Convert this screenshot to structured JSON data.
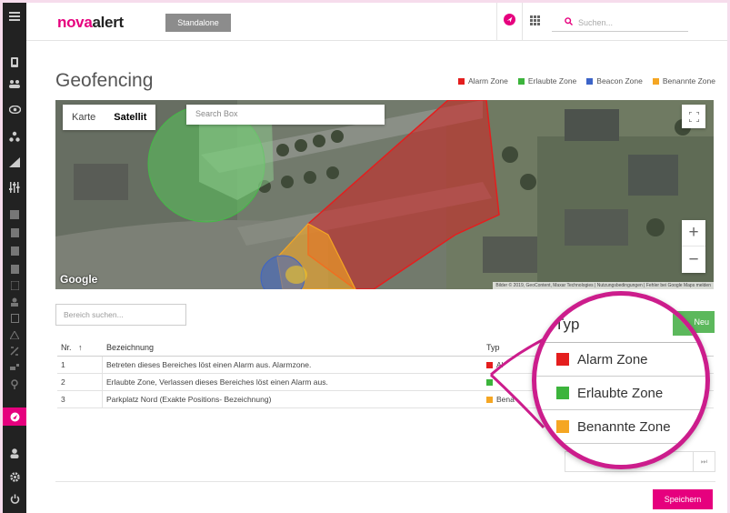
{
  "brand": {
    "part1": "nova",
    "part2": "alert"
  },
  "mode_label": "Standalone",
  "topbar": {
    "search_placeholder": "Suchen..."
  },
  "page": {
    "title": "Geofencing"
  },
  "legend": [
    {
      "label": "Alarm Zone",
      "color": "#e41e1e"
    },
    {
      "label": "Erlaubte Zone",
      "color": "#3cb43c"
    },
    {
      "label": "Beacon Zone",
      "color": "#3c64c8"
    },
    {
      "label": "Benannte Zone",
      "color": "#f5a623"
    }
  ],
  "map": {
    "tabs": [
      "Karte",
      "Satellit"
    ],
    "selected_tab": "Satellit",
    "search_placeholder": "Search Box",
    "google": "Google",
    "attribution": "Bilder © 2019, GeoContent, Maxar Technologies | Nutzungsbedingungen | Fehler bei Google Maps melden",
    "zoom_in": "+",
    "zoom_out": "−"
  },
  "filter": {
    "region_placeholder": "Bereich suchen..."
  },
  "add_button": "Neu",
  "table": {
    "headers": {
      "nr": "Nr.",
      "sort": "↑",
      "bez": "Bezeichnung",
      "typ": "Typ"
    },
    "rows": [
      {
        "nr": "1",
        "bez": "Betreten dieses Bereiches löst einen Alarm aus. Alarmzone.",
        "typ": "Al",
        "color": "#e41e1e"
      },
      {
        "nr": "2",
        "bez": "Erlaubte Zone, Verlassen dieses Bereiches löst einen Alarm aus.",
        "typ": "",
        "color": "#3cb43c"
      },
      {
        "nr": "3",
        "bez": "Parkplatz Nord (Exakte Positions- Bezeichnung)",
        "typ": "Bena",
        "color": "#f5a623"
      }
    ]
  },
  "pager": {
    "last": "⏭"
  },
  "save_button": "Speichern",
  "callout": {
    "header": "Typ",
    "rows": [
      {
        "label": "Alarm Zone",
        "color": "#e41e1e"
      },
      {
        "label": "Erlaubte Zone",
        "color": "#3cb43c"
      },
      {
        "label": "Benannte Zone",
        "color": "#f5a623"
      }
    ]
  },
  "colors": {
    "accent": "#e6007e",
    "callout_ring": "#cc1d8c",
    "add_button": "#5cb85c"
  },
  "sidebar_icons": [
    "menu-icon",
    "phone-icon",
    "people-icon",
    "eye-icon",
    "network-icon",
    "signal-icon",
    "sliders-icon",
    "grid-icon",
    "doc-icon",
    "list-icon",
    "calendar-icon",
    "note-icon",
    "users-icon",
    "square-icon",
    "warning-icon",
    "map-icon",
    "keys-icon",
    "location-icon",
    "geofence-icon",
    "user-icon",
    "settings-icon",
    "power-icon"
  ]
}
